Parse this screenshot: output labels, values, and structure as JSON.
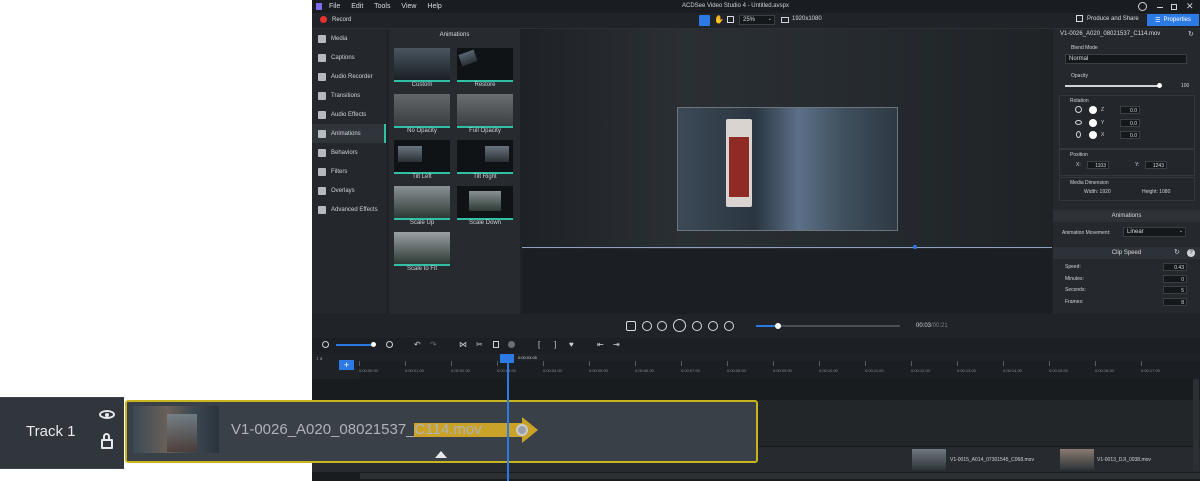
{
  "window": {
    "title": "ACDSee Video Studio 4 - Untitled.avspx",
    "menu": [
      "File",
      "Edit",
      "Tools",
      "View",
      "Help"
    ]
  },
  "toolbar": {
    "record_label": "Record",
    "zoom_value": "25%",
    "resolution": "1920x1080",
    "produce_label": "Produce and Share",
    "properties_label": "Properties"
  },
  "sidebar": {
    "items": [
      {
        "label": "Media",
        "icon": "media-icon"
      },
      {
        "label": "Captions",
        "icon": "captions-icon"
      },
      {
        "label": "Audio Recorder",
        "icon": "microphone-icon"
      },
      {
        "label": "Transitions",
        "icon": "transitions-icon"
      },
      {
        "label": "Audio Effects",
        "icon": "audio-effects-icon"
      },
      {
        "label": "Animations",
        "icon": "animations-icon"
      },
      {
        "label": "Behaviors",
        "icon": "behaviors-icon"
      },
      {
        "label": "Filters",
        "icon": "filters-icon"
      },
      {
        "label": "Overlays",
        "icon": "overlays-icon"
      },
      {
        "label": "Advanced Effects",
        "icon": "advanced-effects-icon"
      }
    ]
  },
  "animations_panel": {
    "title": "Animations",
    "items": [
      "Custom",
      "Restore",
      "No Opacity",
      "Full Opacity",
      "Tilt Left",
      "Tilt Right",
      "Scale Up",
      "Scale Down",
      "Scale to Fit"
    ]
  },
  "properties": {
    "clip_name": "V1-0026_A020_08021537_C114.mov",
    "blend_mode_label": "Blend Mode",
    "blend_mode_value": "Normal",
    "opacity_label": "Opacity",
    "opacity_value": "100",
    "rotation_label": "Rotation",
    "rotation_z": "0.0",
    "rotation_y": "0.0",
    "rotation_x": "0.0",
    "axis_z": "Z",
    "axis_y": "Y",
    "axis_x": "X",
    "position_label": "Position",
    "pos_x_label": "X:",
    "pos_x": "1103",
    "pos_y_label": "Y:",
    "pos_y": "1243",
    "media_dimension_label": "Media Dimension",
    "width_text": "Width: 1920",
    "height_text": "Height: 1080",
    "animations_header": "Animations",
    "animation_movement_label": "Animation Movement:",
    "animation_movement_value": "Linear",
    "clip_speed_header": "Clip Speed",
    "speed_label": "Speed:",
    "speed_value": "0.43",
    "minutes_label": "Minutes:",
    "minutes_value": "0",
    "seconds_label": "Seconds:",
    "seconds_value": "5",
    "frames_label": "Frames:",
    "frames_value": "8"
  },
  "playback": {
    "current_time": "00:03",
    "total_time": "00:21",
    "progress": 0.15
  },
  "timeline": {
    "playhead_time": "0:00:03.05",
    "ruler_ticks": [
      "0:00:00.00",
      "0:00:01.00",
      "0:00:02.00",
      "0:00:03.00",
      "0:00:04.00",
      "0:00:05.00",
      "0:00:06.00",
      "0:00:07.00",
      "0:00:08.00",
      "0:00:09.00",
      "0:00:10.00",
      "0:00:11.00",
      "0:00:12.00",
      "0:00:13.00",
      "0:00:14.00",
      "0:00:15.00",
      "0:00:16.00",
      "0:00:17.00"
    ],
    "track_label": "Track 1",
    "clip_name": "V1-0026_A020_08021537_C114.mov",
    "other_clips": [
      "V1-0015_A014_07301545_C068.mov",
      "V1-0013_DJI_0038.mov"
    ]
  },
  "colors": {
    "accent_teal": "#2fc0a5",
    "accent_blue": "#2c7be5",
    "record_red": "#e8322e",
    "clip_border": "#c8b41c",
    "arrow_gold": "#c9a227"
  }
}
